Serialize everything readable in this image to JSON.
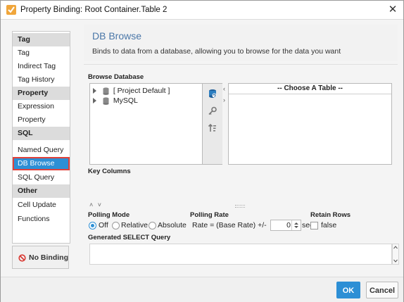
{
  "window": {
    "title": "Property Binding: Root Container.Table 2",
    "close_glyph": "✕"
  },
  "sidebar": {
    "rows": [
      {
        "label": "Tag",
        "kind": "section"
      },
      {
        "label": "Tag",
        "kind": "item"
      },
      {
        "label": "Indirect Tag",
        "kind": "item"
      },
      {
        "label": "Tag History",
        "kind": "item"
      },
      {
        "label": "Property",
        "kind": "section"
      },
      {
        "label": "Expression",
        "kind": "item"
      },
      {
        "label": "Property",
        "kind": "item"
      },
      {
        "label": "SQL",
        "kind": "section"
      },
      {
        "label": "Named Query",
        "kind": "item"
      },
      {
        "label": "DB Browse",
        "kind": "selected"
      },
      {
        "label": "SQL Query",
        "kind": "item"
      },
      {
        "label": "Other",
        "kind": "section"
      },
      {
        "label": "Cell Update",
        "kind": "item"
      },
      {
        "label": "Functions",
        "kind": "item"
      }
    ],
    "no_binding_label": "No Binding"
  },
  "header": {
    "title": "DB Browse",
    "description": "Binds to data from a database, allowing you to browse for the data you want"
  },
  "browse": {
    "label": "Browse Database",
    "tree": [
      "[ Project Default ]",
      "MySQL"
    ],
    "table_placeholder": "-- Choose A Table --"
  },
  "key_columns_label": "Key Columns",
  "polling": {
    "mode_label": "Polling Mode",
    "options": [
      "Off",
      "Relative",
      "Absolute"
    ],
    "selected": "Off",
    "rate_label": "Polling Rate",
    "rate_prefix": "Rate = (Base Rate) +/-",
    "rate_value": "0",
    "rate_unit": "sec"
  },
  "retain_rows": {
    "label": "Retain Rows",
    "value_text": "false",
    "checked": false
  },
  "generated_query_label": "Generated SELECT Query",
  "buttons": {
    "ok": "OK",
    "cancel": "Cancel"
  },
  "colors": {
    "accent": "#2d8fd5",
    "selection_outline": "#e0413a",
    "header_title": "#4a77a8"
  }
}
